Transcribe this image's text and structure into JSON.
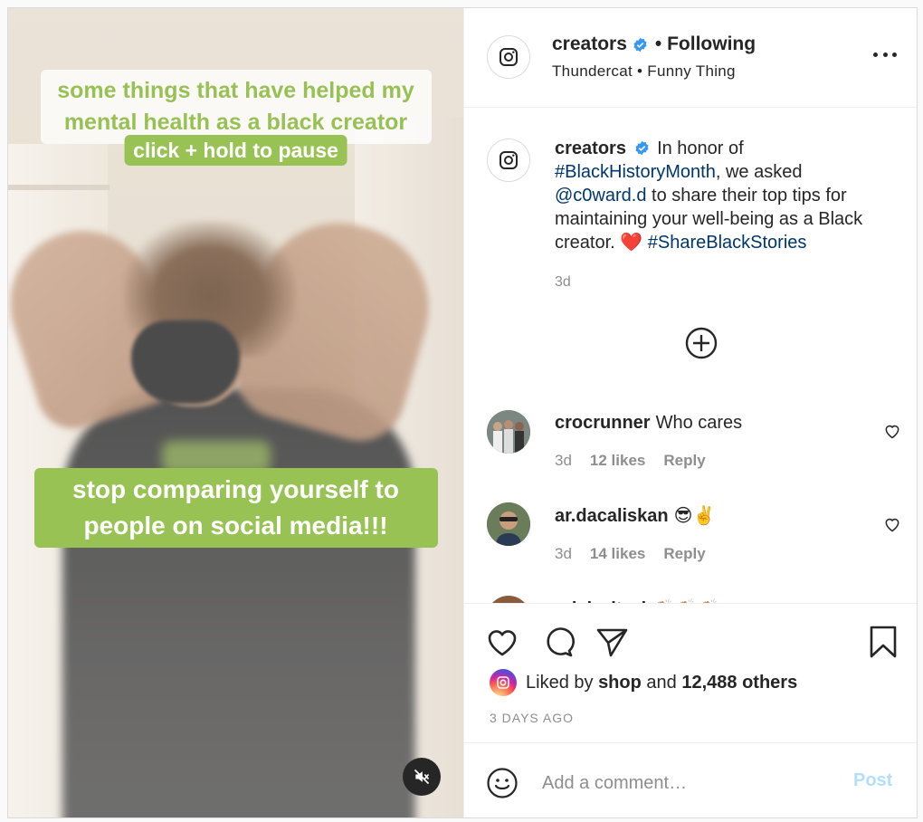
{
  "media": {
    "caption_top": "some things that have helped my mental health as a black creator",
    "caption_pause": "click + hold to pause",
    "caption_main": "stop comparing yourself to people on social media!!!",
    "mute_icon": "speaker-muted-icon"
  },
  "header": {
    "username": "creators",
    "following_label": "• Following",
    "song": "Thundercat • Funny Thing"
  },
  "caption": {
    "username": "creators",
    "text_1": "In honor of",
    "hashtag_1": "#BlackHistoryMonth",
    "text_2": ", we asked",
    "mention": "@c0ward.d",
    "text_3": "to share their top tips for maintaining your well-being as a Black creator.",
    "heart_emoji": "❤️",
    "hashtag_2": "#ShareBlackStories",
    "time": "3d"
  },
  "comments": [
    {
      "username": "crocrunner",
      "text": "Who cares",
      "time": "3d",
      "likes": "12 likes",
      "reply": "Reply"
    },
    {
      "username": "ar.dacaliskan",
      "text": "😎✌️",
      "time": "3d",
      "likes": "14 likes",
      "reply": "Reply"
    },
    {
      "username": "erickwitzel",
      "text": "👏🏼👏🏼👏🏼"
    }
  ],
  "actions": {
    "liked_prefix": "Liked by",
    "liked_user": "shop",
    "liked_and": "and",
    "liked_others": "12,488 others",
    "posted": "3 DAYS AGO"
  },
  "add_comment": {
    "placeholder": "Add a comment…",
    "post_label": "Post"
  },
  "colors": {
    "link": "#00376b",
    "verified": "#3897f0",
    "caption_green": "#98c354",
    "post_disabled": "#b2dffc"
  }
}
